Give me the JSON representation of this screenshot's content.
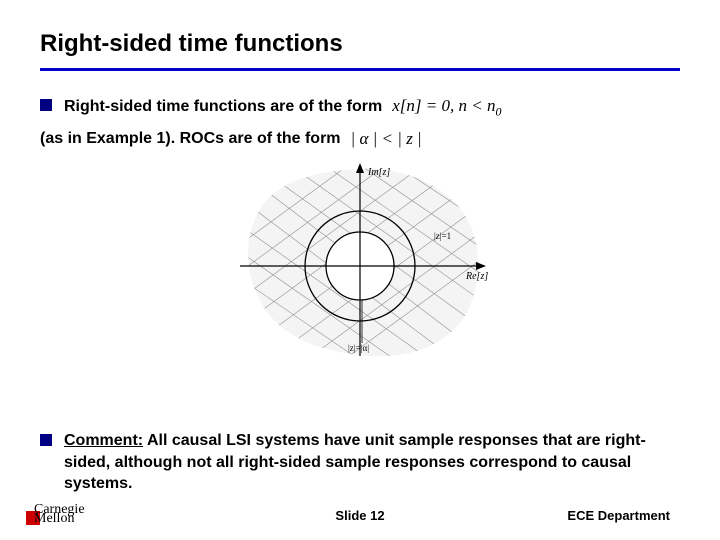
{
  "title": "Right-sided time functions",
  "bullet1": {
    "text": "Right-sided time functions are of the form",
    "math": "x[n] = 0,  n < n",
    "math_sub": "0"
  },
  "line2": {
    "text": "(as in Example 1).  ROCs are of the form",
    "math_left": "| α | < | z |"
  },
  "figure": {
    "im_label": "Im[z]",
    "re_label": "Re[z]",
    "unit_label": "|z|=1",
    "alpha_label": "|z|=|α|"
  },
  "comment": {
    "label": "Comment:",
    "body": " All causal LSI systems have unit sample responses that are right-sided, although not all right-sided sample responses correspond to causal systems."
  },
  "footer": {
    "logo_line1": "Carnegie",
    "logo_line2": "Mellon",
    "slide": "Slide 12",
    "dept": "ECE Department"
  }
}
